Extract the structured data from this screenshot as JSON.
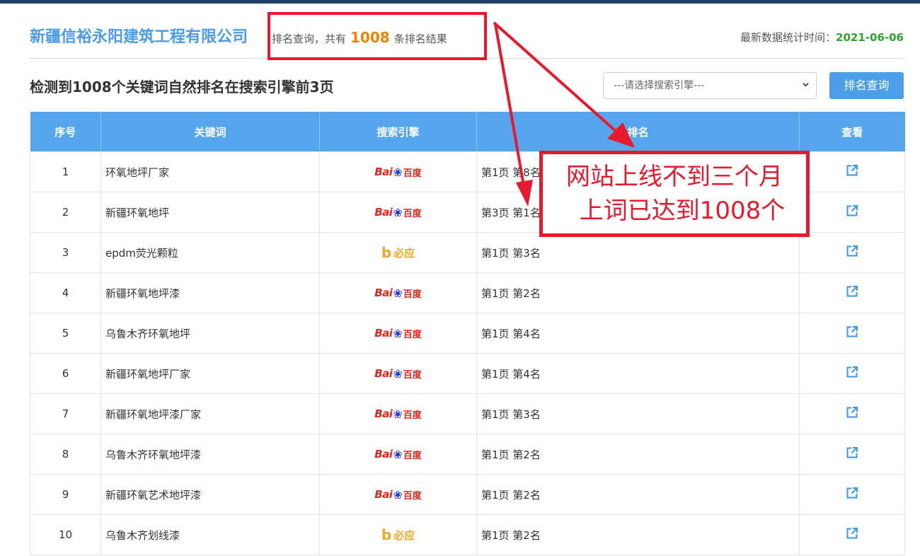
{
  "header": {
    "company_name": "新疆信裕永阳建筑工程有限公司",
    "query_prefix": "排名查询，共有",
    "result_count": "1008",
    "query_suffix": "条排名结果",
    "stat_label": "最新数据统计时间：",
    "stat_date": "2021-06-06"
  },
  "summary": "检测到1008个关键词自然排名在搜索引擎前3页",
  "controls": {
    "engine_select_value": "---请选择搜索引擎---",
    "query_button": "排名查询"
  },
  "table": {
    "headers": [
      "序号",
      "关键词",
      "搜索引擎",
      "排名",
      "查看"
    ],
    "rows": [
      {
        "idx": "1",
        "keyword": "环氧地坪厂家",
        "engine": "baidu",
        "rank": "第1页 第8名"
      },
      {
        "idx": "2",
        "keyword": "新疆环氧地坪",
        "engine": "baidu",
        "rank": "第3页 第1名"
      },
      {
        "idx": "3",
        "keyword": "epdm荧光颗粒",
        "engine": "bing",
        "rank": "第1页 第3名"
      },
      {
        "idx": "4",
        "keyword": "新疆环氧地坪漆",
        "engine": "baidu",
        "rank": "第1页 第2名"
      },
      {
        "idx": "5",
        "keyword": "乌鲁木齐环氧地坪",
        "engine": "baidu",
        "rank": "第1页 第4名"
      },
      {
        "idx": "6",
        "keyword": "新疆环氧地坪厂家",
        "engine": "baidu",
        "rank": "第1页 第4名"
      },
      {
        "idx": "7",
        "keyword": "新疆环氧地坪漆厂家",
        "engine": "baidu",
        "rank": "第1页 第3名"
      },
      {
        "idx": "8",
        "keyword": "乌鲁木齐环氧地坪漆",
        "engine": "baidu",
        "rank": "第1页 第2名"
      },
      {
        "idx": "9",
        "keyword": "新疆环氧艺术地坪漆",
        "engine": "baidu",
        "rank": "第1页 第2名"
      },
      {
        "idx": "10",
        "keyword": "乌鲁木齐划线漆",
        "engine": "bing",
        "rank": "第1页 第2名"
      }
    ]
  },
  "engines": {
    "baidu": {
      "text_bai": "Bai",
      "text_cn": "百度",
      "icon": "baidu-paw-icon"
    },
    "bing": {
      "text": "必应",
      "icon": "bing-b-icon"
    }
  },
  "annotation": {
    "line1": "网站上线不到三个月",
    "line2": "上词已达到1008个",
    "color": "#e8192c"
  },
  "colors": {
    "accent": "#4b9ce8",
    "table_header": "#55a6ec",
    "count": "#f08300",
    "date": "#2aa52a"
  }
}
